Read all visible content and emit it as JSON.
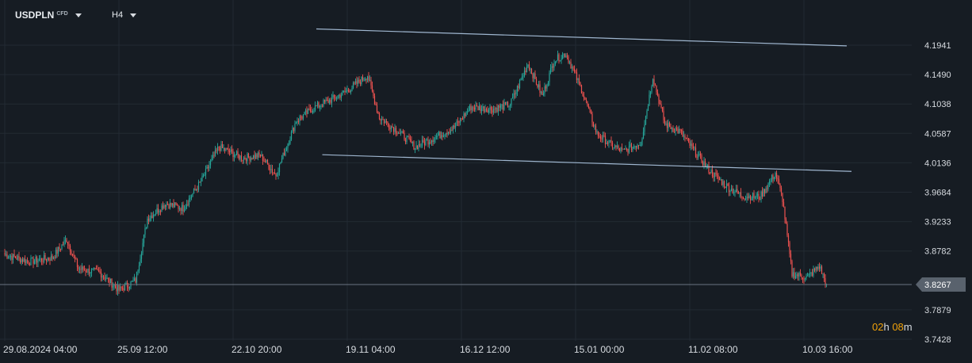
{
  "toolbar": {
    "symbol": "USDPLN",
    "symbol_tag": "CFD",
    "timeframe": "H4"
  },
  "countdown": {
    "h_value": "02",
    "h_unit": "h",
    "m_value": "08",
    "m_unit": "m"
  },
  "colors": {
    "background": "#161c23",
    "grid": "#222a33",
    "up": "#26a69a",
    "down": "#ef5350",
    "trendline": "#9fb6cf",
    "price_line": "#6b7480",
    "price_tag": "#59626d",
    "countdown_number": "#f0a10a"
  },
  "chart_data": {
    "type": "candlestick",
    "title": "",
    "xlabel": "",
    "ylabel": "",
    "current_price": "3.8267",
    "current_price_value": 3.8267,
    "y_tick_labels": [
      "4.1941",
      "4.1490",
      "4.1038",
      "4.0587",
      "4.0136",
      "3.9684",
      "3.9233",
      "3.8782",
      "3.7879",
      "3.7428"
    ],
    "y_ticks": [
      4.1941,
      4.149,
      4.1038,
      4.0587,
      4.0136,
      3.9684,
      3.9233,
      3.8782,
      3.7879,
      3.7428
    ],
    "ylim": [
      3.7428,
      4.1941
    ],
    "x_tick_labels": [
      "29.08.2024  04:00",
      "25.09  12:00",
      "22.10  20:00",
      "19.11  04:00",
      "16.12  12:00",
      "15.01  00:00",
      "11.02  08:00",
      "10.03  16:00"
    ],
    "x_tick_bars": [
      0,
      96,
      192,
      288,
      384,
      480,
      576,
      672
    ],
    "bar_count": 692,
    "grid": true,
    "path_anchors": [
      [
        0,
        3.873
      ],
      [
        20,
        3.862
      ],
      [
        40,
        3.868
      ],
      [
        52,
        3.896
      ],
      [
        62,
        3.851
      ],
      [
        80,
        3.845
      ],
      [
        96,
        3.818
      ],
      [
        110,
        3.833
      ],
      [
        120,
        3.928
      ],
      [
        135,
        3.951
      ],
      [
        150,
        3.944
      ],
      [
        165,
        3.985
      ],
      [
        180,
        4.038
      ],
      [
        200,
        4.021
      ],
      [
        215,
        4.025
      ],
      [
        228,
        3.995
      ],
      [
        245,
        4.078
      ],
      [
        260,
        4.098
      ],
      [
        275,
        4.111
      ],
      [
        288,
        4.124
      ],
      [
        305,
        4.148
      ],
      [
        315,
        4.083
      ],
      [
        330,
        4.063
      ],
      [
        345,
        4.038
      ],
      [
        360,
        4.051
      ],
      [
        378,
        4.068
      ],
      [
        392,
        4.099
      ],
      [
        410,
        4.096
      ],
      [
        425,
        4.103
      ],
      [
        440,
        4.166
      ],
      [
        452,
        4.116
      ],
      [
        462,
        4.171
      ],
      [
        472,
        4.181
      ],
      [
        485,
        4.126
      ],
      [
        498,
        4.058
      ],
      [
        510,
        4.041
      ],
      [
        520,
        4.031
      ],
      [
        535,
        4.045
      ],
      [
        545,
        4.146
      ],
      [
        555,
        4.073
      ],
      [
        568,
        4.061
      ],
      [
        580,
        4.031
      ],
      [
        593,
        4.001
      ],
      [
        608,
        3.976
      ],
      [
        620,
        3.963
      ],
      [
        635,
        3.961
      ],
      [
        648,
        3.998
      ],
      [
        654,
        3.958
      ],
      [
        662,
        3.843
      ],
      [
        675,
        3.838
      ],
      [
        685,
        3.855
      ],
      [
        691,
        3.8267
      ]
    ],
    "trendlines": [
      {
        "name": "",
        "points": [
          [
            262,
            4.219
          ],
          [
            708,
            4.193
          ]
        ]
      },
      {
        "name": "",
        "points": [
          [
            267,
            4.026
          ],
          [
            712,
            4.0004
          ]
        ]
      }
    ]
  }
}
